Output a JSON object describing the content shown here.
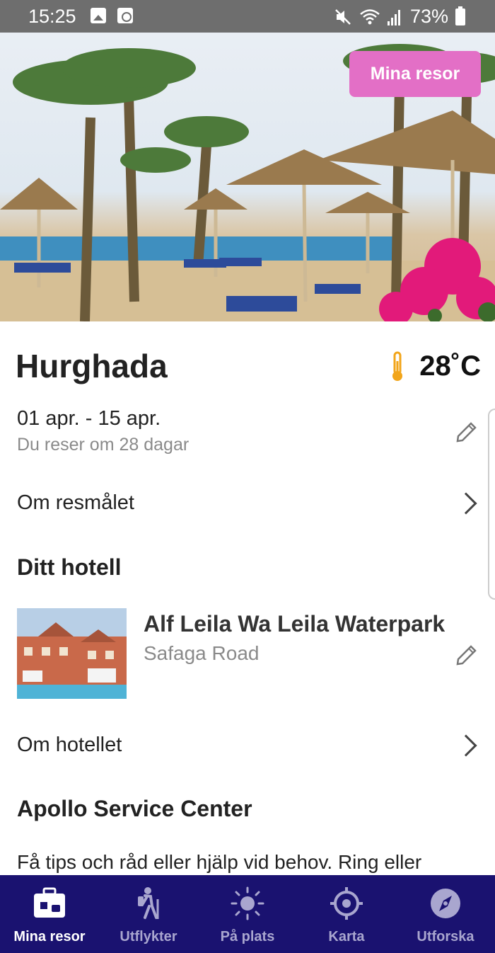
{
  "status_bar": {
    "time": "15:25",
    "battery": "73%"
  },
  "hero": {
    "trips_button": "Mina resor"
  },
  "destination": {
    "name": "Hurghada",
    "temperature": "28˚C",
    "dates": "01 apr. - 15 apr.",
    "countdown": "Du reser om 28 dagar",
    "about_link": "Om resmålet"
  },
  "hotel": {
    "heading": "Ditt hotell",
    "name": "Alf Leila Wa Leila Waterpark",
    "address": "Safaga Road",
    "about_link": "Om hotellet"
  },
  "service": {
    "heading": "Apollo Service Center",
    "text": "Få tips och råd eller hjälp vid behov. Ring eller"
  },
  "bottom_nav": {
    "items": [
      {
        "label": "Mina resor",
        "icon": "suitcase-icon",
        "active": true
      },
      {
        "label": "Utflykter",
        "icon": "hiker-icon",
        "active": false
      },
      {
        "label": "På plats",
        "icon": "sun-icon",
        "active": false
      },
      {
        "label": "Karta",
        "icon": "location-target-icon",
        "active": false
      },
      {
        "label": "Utforska",
        "icon": "compass-icon",
        "active": false
      }
    ]
  },
  "colors": {
    "accent_pink": "#e36fc6",
    "nav_background": "#1a1270",
    "thermometer": "#f2a51a"
  }
}
